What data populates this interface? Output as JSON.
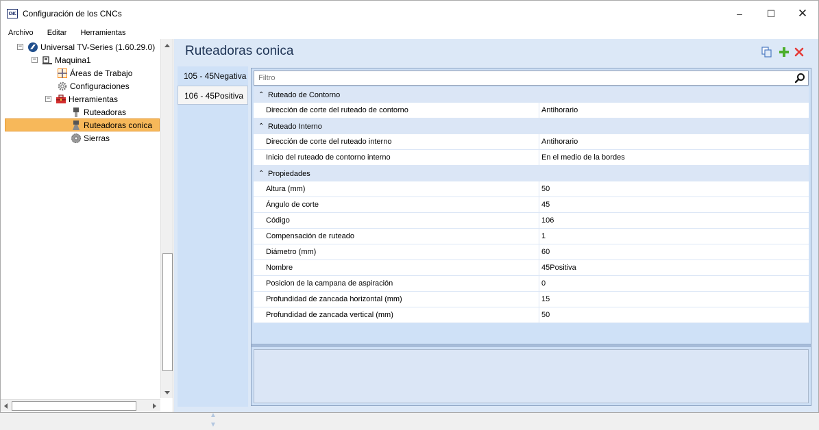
{
  "window": {
    "title": "Configuración de los CNCs",
    "icon_text": "CNC",
    "minimize": "–",
    "maximize": "☐",
    "close": "✕"
  },
  "menu": [
    "Archivo",
    "Editar",
    "Herramientas"
  ],
  "tree": [
    {
      "label": "Universal TV-Series (1.60.29.0)",
      "toggle": "−",
      "icon": "universal-logo-icon",
      "selected": false
    },
    {
      "label": "Maquina1",
      "toggle": "−",
      "icon": "machine-icon",
      "selected": false
    },
    {
      "label": "Áreas de Trabajo",
      "toggle": "",
      "icon": "work-areas-icon",
      "selected": false
    },
    {
      "label": "Configuraciones",
      "toggle": "",
      "icon": "gear-icon",
      "selected": false
    },
    {
      "label": "Herramientas",
      "toggle": "−",
      "icon": "toolbox-icon",
      "selected": false
    },
    {
      "label": "Ruteadoras",
      "toggle": "",
      "icon": "router-bit-icon",
      "selected": false
    },
    {
      "label": "Ruteadoras conica",
      "toggle": "",
      "icon": "conical-router-icon",
      "selected": true
    },
    {
      "label": "Sierras",
      "toggle": "",
      "icon": "saw-icon",
      "selected": false
    }
  ],
  "main": {
    "title": "Ruteadoras conica",
    "tabs": [
      {
        "label": "105 - 45Negativa",
        "active": false
      },
      {
        "label": "106 - 45Positiva",
        "active": true
      }
    ],
    "filter_placeholder": "Filtro",
    "categories": [
      {
        "name": "Ruteado de Contorno",
        "props": [
          {
            "name": "Dirección de corte del ruteado de contorno",
            "value": "Antihorario"
          }
        ]
      },
      {
        "name": "Ruteado Interno",
        "props": [
          {
            "name": "Dirección de corte del ruteado interno",
            "value": "Antihorario"
          },
          {
            "name": "Inicio del ruteado de contorno interno",
            "value": "En el medio de la bordes"
          }
        ]
      },
      {
        "name": "Propiedades",
        "props": [
          {
            "name": "Altura (mm)",
            "value": "50"
          },
          {
            "name": "Ángulo de corte",
            "value": "45"
          },
          {
            "name": "Código",
            "value": "106"
          },
          {
            "name": "Compensación de ruteado",
            "value": "1"
          },
          {
            "name": "Diámetro (mm)",
            "value": "60"
          },
          {
            "name": "Nombre",
            "value": "45Positiva"
          },
          {
            "name": "Posicion de la campana de aspiración",
            "value": "0"
          },
          {
            "name": "Profundidad de zancada horizontal (mm)",
            "value": "15"
          },
          {
            "name": "Profundidad de zancada vertical (mm)",
            "value": "50"
          }
        ]
      }
    ]
  },
  "colors": {
    "selected_bg": "#f7b85a",
    "panel_bg": "#dce8f7",
    "category_bg": "#dbe6f6",
    "add_icon": "#4caf2a",
    "delete_icon": "#e53935"
  }
}
